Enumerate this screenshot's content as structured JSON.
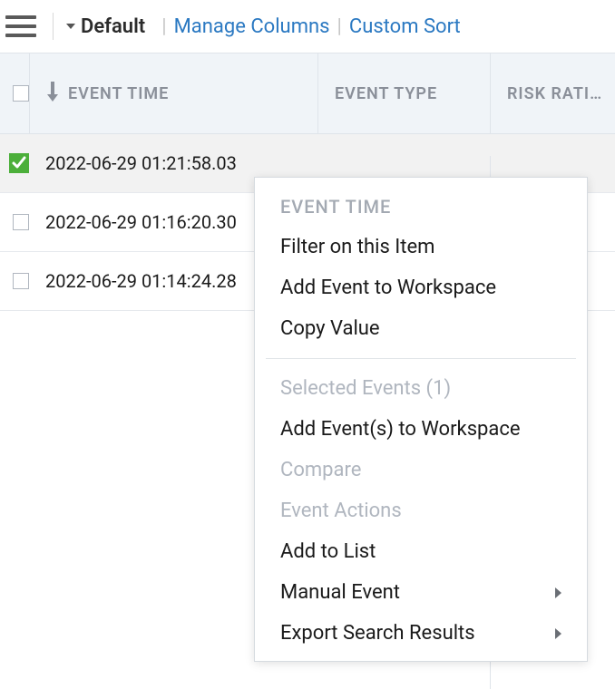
{
  "toolbar": {
    "preset_label": "Default",
    "manage_columns": "Manage Columns",
    "custom_sort": "Custom Sort"
  },
  "columns": {
    "event_time": "EVENT TIME",
    "event_type": "EVENT TYPE",
    "risk_rating": "RISK RATI…"
  },
  "rows": [
    {
      "time": "2022-06-29 01:21:58.03",
      "selected": true
    },
    {
      "time": "2022-06-29 01:16:20.30",
      "selected": false
    },
    {
      "time": "2022-06-29 01:14:24.28",
      "selected": false
    }
  ],
  "context_menu": {
    "section_event_time": "EVENT TIME",
    "filter_item": "Filter on this Item",
    "add_event_ws": "Add Event to Workspace",
    "copy_value": "Copy Value",
    "selected_events_header": "Selected Events (1)",
    "add_events_ws": "Add Event(s) to Workspace",
    "compare": "Compare",
    "event_actions": "Event Actions",
    "add_to_list": "Add to List",
    "manual_event": "Manual Event",
    "export_search": "Export Search Results"
  }
}
